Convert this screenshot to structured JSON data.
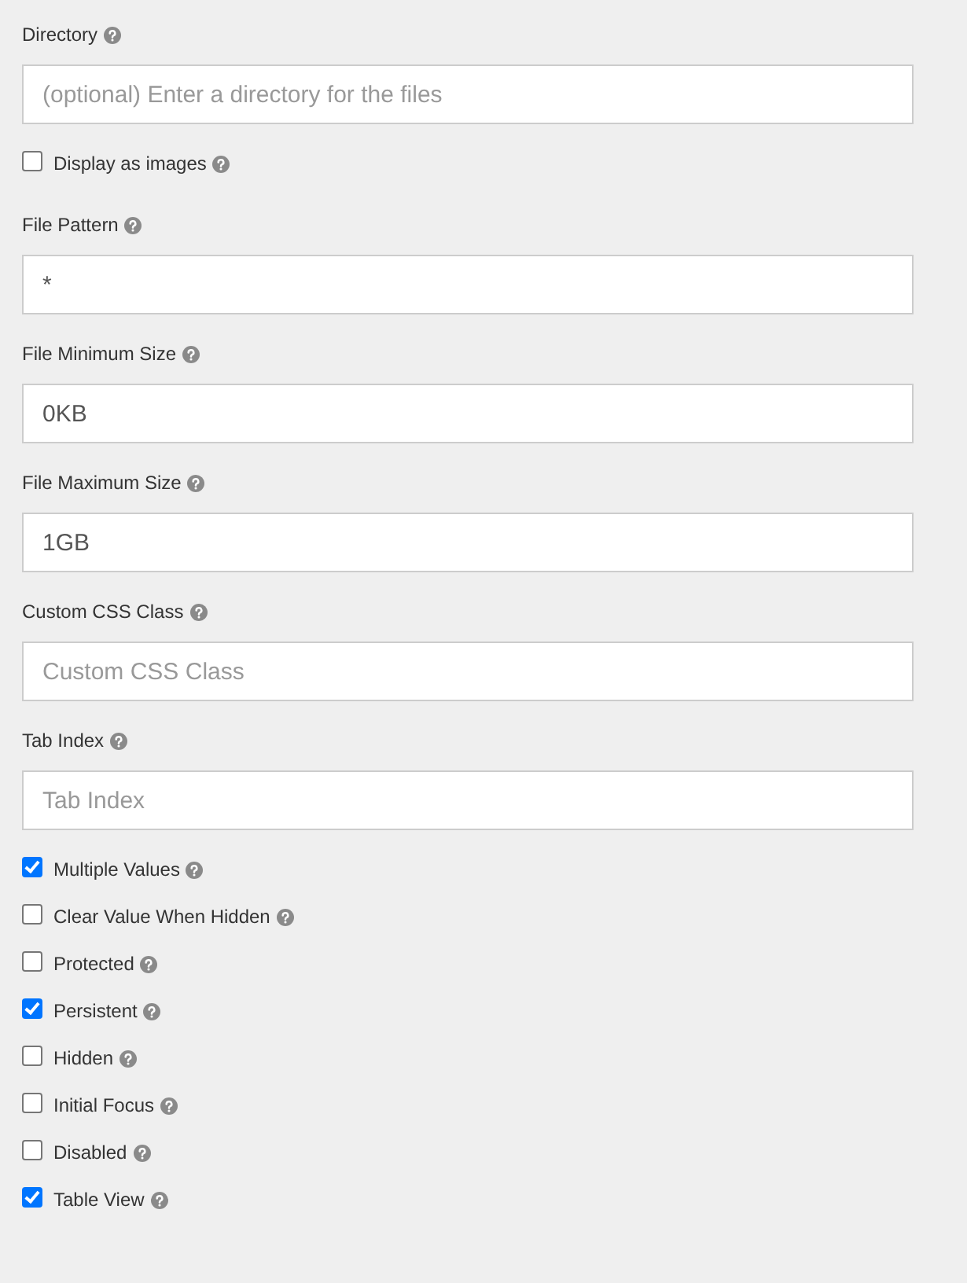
{
  "items": [
    {
      "kind": "field",
      "label": "Directory",
      "placeholder": "(optional) Enter a directory for the files"
    },
    {
      "kind": "checkbox",
      "label": "Display as images",
      "checked": false
    },
    {
      "kind": "field",
      "label": "File Pattern",
      "value": "*"
    },
    {
      "kind": "field",
      "label": "File Minimum Size",
      "value": "0KB"
    },
    {
      "kind": "field",
      "label": "File Maximum Size",
      "value": "1GB"
    },
    {
      "kind": "field",
      "label": "Custom CSS Class",
      "placeholder": "Custom CSS Class"
    },
    {
      "kind": "field",
      "label": "Tab Index",
      "placeholder": "Tab Index"
    },
    {
      "kind": "checkbox",
      "label": "Multiple Values",
      "checked": true
    },
    {
      "kind": "checkbox",
      "label": "Clear Value When Hidden",
      "checked": false
    },
    {
      "kind": "checkbox",
      "label": "Protected",
      "checked": false
    },
    {
      "kind": "checkbox",
      "label": "Persistent",
      "checked": true
    },
    {
      "kind": "checkbox",
      "label": "Hidden",
      "checked": false
    },
    {
      "kind": "checkbox",
      "label": "Initial Focus",
      "checked": false
    },
    {
      "kind": "checkbox",
      "label": "Disabled",
      "checked": false
    },
    {
      "kind": "checkbox",
      "label": "Table View",
      "checked": true
    }
  ]
}
